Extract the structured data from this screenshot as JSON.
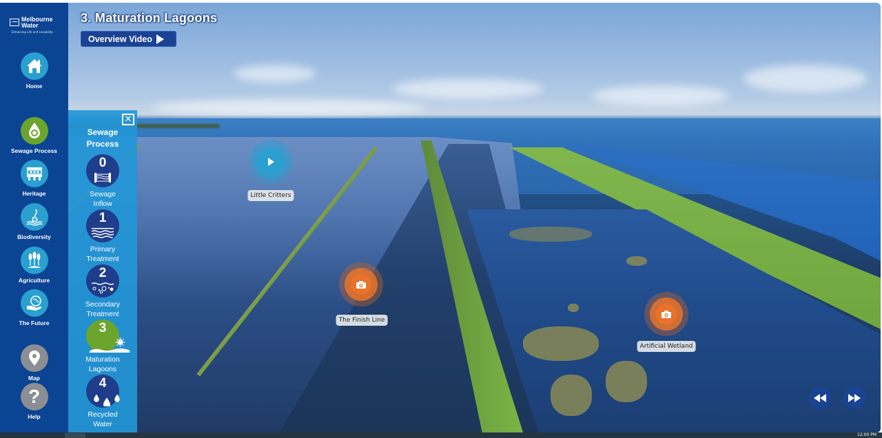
{
  "brand": {
    "name_line1": "Melbourne",
    "name_line2": "Water",
    "tagline": "Enhancing Life and Liveability"
  },
  "sidebar": {
    "items": [
      {
        "label": "Home",
        "icon": "home-icon"
      },
      {
        "label": "Sewage Process",
        "icon": "water-drop-recycle-icon"
      },
      {
        "label": "Heritage",
        "icon": "heritage-building-icon"
      },
      {
        "label": "Biodiversity",
        "icon": "heron-bird-icon"
      },
      {
        "label": "Agriculture",
        "icon": "wheat-icon"
      },
      {
        "label": "The Future",
        "icon": "globe-in-hand-icon"
      },
      {
        "label": "Map",
        "icon": "map-pin-icon"
      },
      {
        "label": "Help",
        "icon": "question-mark-icon"
      }
    ]
  },
  "subpanel": {
    "title_line1": "Sewage",
    "title_line2": "Process",
    "close_icon": "close-icon",
    "steps": [
      {
        "number": "0",
        "line1": "Sewage",
        "line2": "Inflow",
        "active": false
      },
      {
        "number": "1",
        "line1": "Primary",
        "line2": "Treatment",
        "active": false
      },
      {
        "number": "2",
        "line1": "Secondary",
        "line2": "Treatment",
        "active": false
      },
      {
        "number": "3",
        "line1": "Maturation",
        "line2": "Lagoons",
        "active": true
      },
      {
        "number": "4",
        "line1": "Recycled",
        "line2": "Water",
        "active": false
      }
    ]
  },
  "header": {
    "title": "3. Maturation Lagoons",
    "video_button": "Overview Video"
  },
  "hotspots": [
    {
      "label": "Little Critters",
      "type": "video",
      "icon": "play-icon"
    },
    {
      "label": "The Finish Line",
      "type": "photo",
      "icon": "camera-icon"
    },
    {
      "label": "Artificial Wetland",
      "type": "photo",
      "icon": "camera-icon"
    }
  ],
  "controls": {
    "previous": "rewind-icon",
    "next": "fast-forward-icon"
  },
  "taskbar": {
    "clock": "12:00 PM"
  },
  "colors": {
    "sidebar": "#0a4493",
    "subpanel": "#2396d7",
    "step_circle": "#1f3d8a",
    "active_step": "#6ba52e",
    "teal_icon": "#2aa0d0",
    "grey_icon": "#8b8e93",
    "photo_hotspot": "#e8732a",
    "video_hotspot": "#2aa0d0"
  }
}
